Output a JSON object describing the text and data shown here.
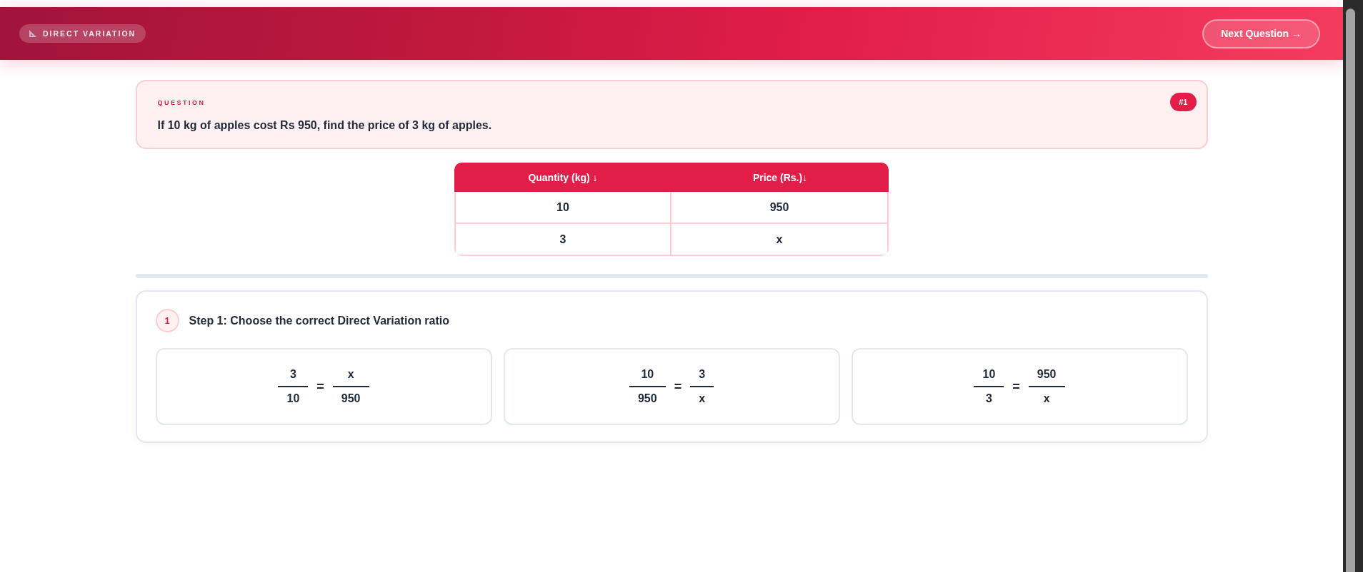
{
  "header": {
    "topic_badge": "DIRECT VARIATION",
    "next_button": "Next Question →"
  },
  "question": {
    "label": "QUESTION",
    "number": "#1",
    "text": "If 10 kg of apples cost Rs 950, find the price of 3 kg of apples."
  },
  "table": {
    "columns": [
      "Quantity (kg) ↓",
      "Price (Rs.)↓"
    ],
    "rows": [
      [
        "10",
        "950"
      ],
      [
        "3",
        "x"
      ]
    ]
  },
  "steps": [
    {
      "number": "1",
      "title": "Step 1: Choose the correct Direct Variation ratio",
      "options": [
        {
          "selected": false,
          "left": {
            "numerator": "3",
            "denominator": "10"
          },
          "operator": "=",
          "right": {
            "numerator": "x",
            "denominator": "950"
          }
        },
        {
          "selected": false,
          "left": {
            "numerator": "10",
            "denominator": "950"
          },
          "operator": "=",
          "right": {
            "numerator": "3",
            "denominator": "x"
          }
        },
        {
          "selected": false,
          "left": {
            "numerator": "10",
            "denominator": "3"
          },
          "operator": "=",
          "right": {
            "numerator": "950",
            "denominator": "x"
          }
        }
      ]
    }
  ]
}
